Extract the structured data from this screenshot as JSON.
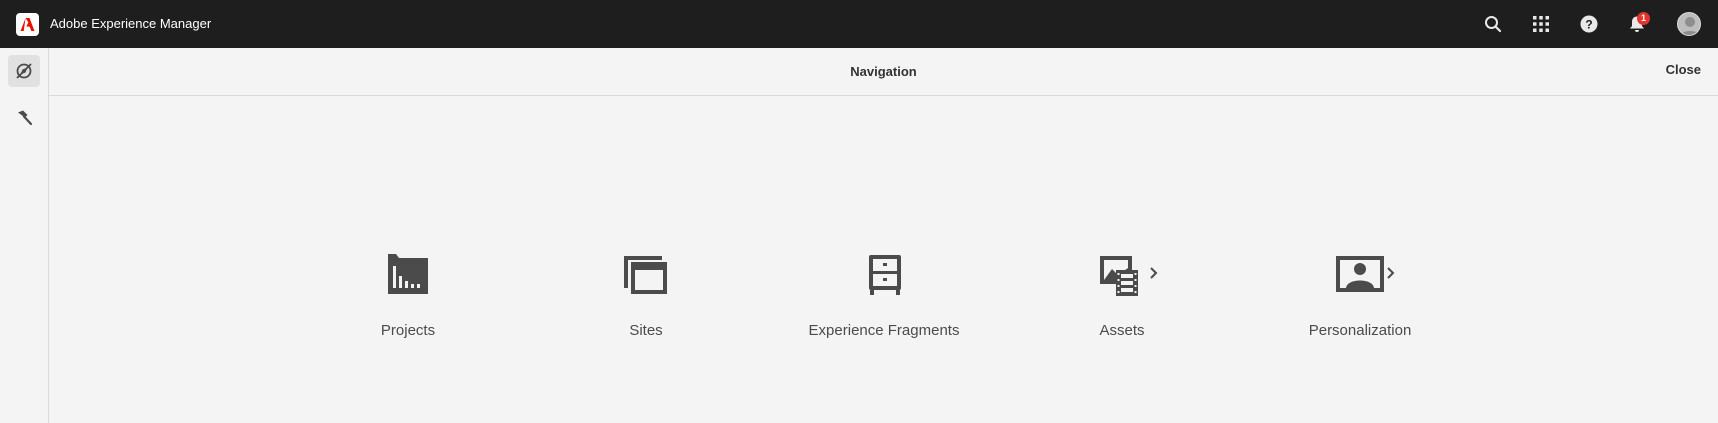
{
  "header": {
    "app_title": "Adobe Experience Manager",
    "notification_count": "1",
    "icons": [
      "adobe-logo-icon",
      "search-icon",
      "apps-grid-icon",
      "help-icon",
      "bell-icon",
      "user-avatar"
    ]
  },
  "rail": {
    "items": [
      {
        "icon": "navigation-compass-icon",
        "active": true
      },
      {
        "icon": "tools-hammer-icon",
        "active": false
      }
    ]
  },
  "navigation": {
    "title": "Navigation",
    "close_label": "Close",
    "tiles": [
      {
        "label": "Projects",
        "icon": "projects-icon",
        "has_children": false
      },
      {
        "label": "Sites",
        "icon": "sites-icon",
        "has_children": false
      },
      {
        "label": "Experience Fragments",
        "icon": "experience-fragments-icon",
        "has_children": false
      },
      {
        "label": "Assets",
        "icon": "assets-icon",
        "has_children": true
      },
      {
        "label": "Personalization",
        "icon": "personalization-icon",
        "has_children": true
      }
    ]
  },
  "colors": {
    "topbar": "#1e1e1e",
    "background": "#f4f4f4",
    "adobe_red": "#eb1000",
    "icon": "#4b4b4b",
    "badge": "#e3342f"
  }
}
